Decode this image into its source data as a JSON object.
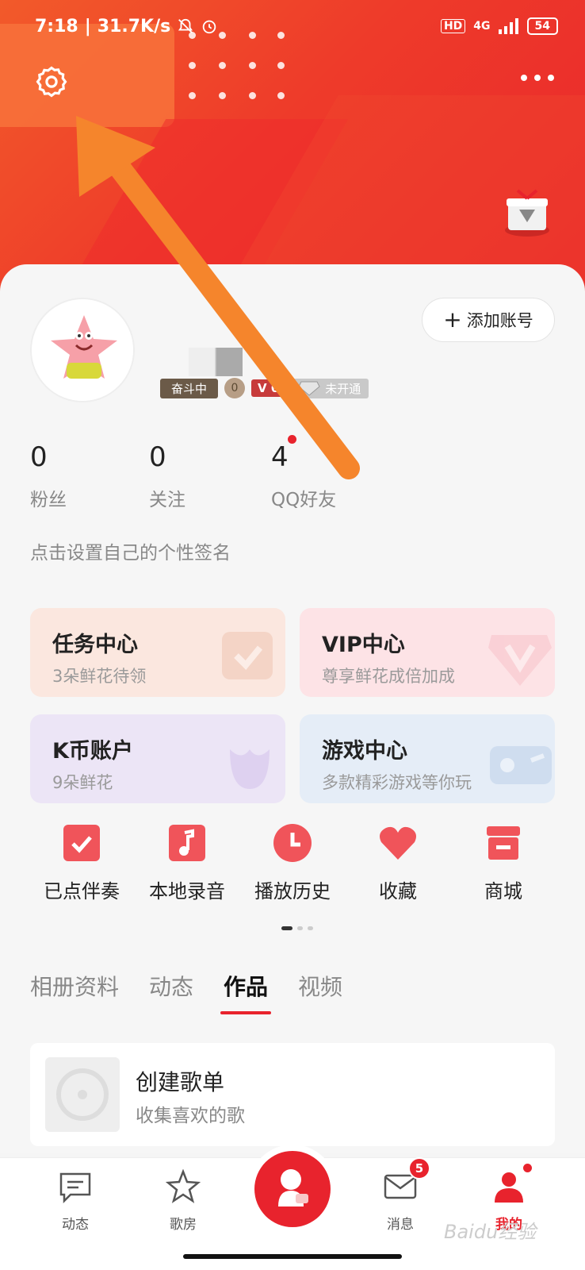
{
  "status_bar": {
    "time": "7:18",
    "speed": "31.7K/s",
    "network": "4G",
    "hd": "HD",
    "battery": "54"
  },
  "header": {
    "settings_icon": "gear-icon",
    "more_icon": "more-dots-icon",
    "gift_icon": "gift-icon"
  },
  "profile": {
    "add_account_label": "添加账号",
    "level_badge": "奋斗中",
    "coin_badge": "0",
    "vip_badge": "V 0",
    "diamond_badge": "未开通",
    "stats": [
      {
        "value": "0",
        "label": "粉丝"
      },
      {
        "value": "0",
        "label": "关注"
      },
      {
        "value": "4",
        "label": "QQ好友"
      }
    ],
    "signature": "点击设置自己的个性签名"
  },
  "tiles": [
    {
      "title": "任务中心",
      "subtitle": "3朵鲜花待领",
      "color": "#fbe7df"
    },
    {
      "title": "VIP中心",
      "subtitle": "尊享鲜花成倍加成",
      "color": "#fde3e6"
    },
    {
      "title": "K币账户",
      "subtitle": "9朵鲜花",
      "color": "#ece5f6"
    },
    {
      "title": "游戏中心",
      "subtitle": "多款精彩游戏等你玩",
      "color": "#e5edf7"
    }
  ],
  "quick_actions": [
    {
      "label": "已点伴奏",
      "icon": "check-square-icon"
    },
    {
      "label": "本地录音",
      "icon": "music-note-icon"
    },
    {
      "label": "播放历史",
      "icon": "clock-icon"
    },
    {
      "label": "收藏",
      "icon": "heart-icon"
    },
    {
      "label": "商城",
      "icon": "shop-icon"
    }
  ],
  "tabs": [
    "相册资料",
    "动态",
    "作品",
    "视频"
  ],
  "active_tab": "作品",
  "playlist": {
    "title": "创建歌单",
    "subtitle": "收集喜欢的歌"
  },
  "bottom_nav": [
    {
      "label": "动态",
      "icon": "chat-icon"
    },
    {
      "label": "歌房",
      "icon": "star-icon"
    },
    {
      "label": "消息",
      "icon": "mail-icon",
      "badge": "5"
    },
    {
      "label": "我的",
      "icon": "person-icon"
    }
  ],
  "watermark": "Baidu经验",
  "accent_color": "#e8232d"
}
